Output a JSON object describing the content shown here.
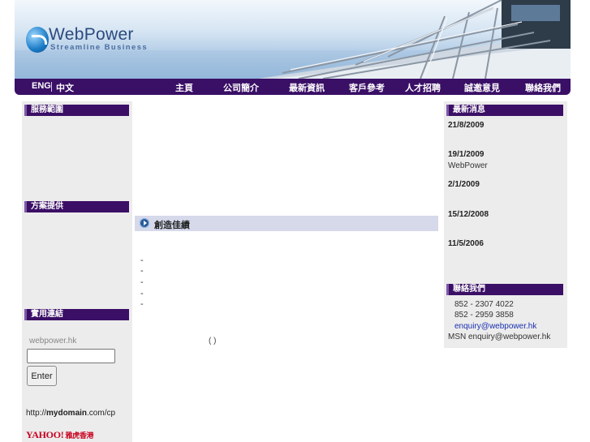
{
  "header": {
    "logo_name": "WebPower",
    "logo_tagline": "Streamline Business"
  },
  "nav": {
    "lang_en": "ENG",
    "lang_zh": "中文",
    "items": [
      "主頁",
      "公司簡介",
      "最新資訊",
      "客戶參考",
      "人才招聘",
      "誠邀意見",
      "聯絡我們"
    ]
  },
  "left": {
    "services_title": "服務範圍",
    "solutions_title": "方案提供",
    "links_title": "實用連結",
    "webpower_label": "webpower.hk",
    "enter_label": "Enter",
    "url_prefix": "http://",
    "url_domain": "mydomain",
    "url_suffix": ".com/cp",
    "yahoo_label": "YAHOO!",
    "yahoo_hk": "雅虎香港"
  },
  "main": {
    "section_title": "創造佳績",
    "bullets": [
      "-",
      "-",
      "-",
      "-",
      "-"
    ],
    "paren": "(  )"
  },
  "right": {
    "news_title": "最新消息",
    "news": [
      {
        "date": "21/8/2009",
        "text": ""
      },
      {
        "date": "19/1/2009",
        "text": "WebPower"
      },
      {
        "date": "2/1/2009",
        "text": ""
      },
      {
        "date": "15/12/2008",
        "text": ""
      },
      {
        "date": "11/5/2006",
        "text": ""
      }
    ],
    "contact_title": "聯絡我們",
    "phone1": "852 - 2307 4022",
    "phone2": "852 - 2959 3858",
    "email": "enquiry@webpower.hk",
    "msn": "MSN enquiry@webpower.hk"
  },
  "colors": {
    "nav_bg": "#3a0f66",
    "panel_bg": "#ececec",
    "section_head_bg": "#3b0f66",
    "mid_head_bg": "#d5d9ea",
    "link": "#1a2fb0"
  }
}
